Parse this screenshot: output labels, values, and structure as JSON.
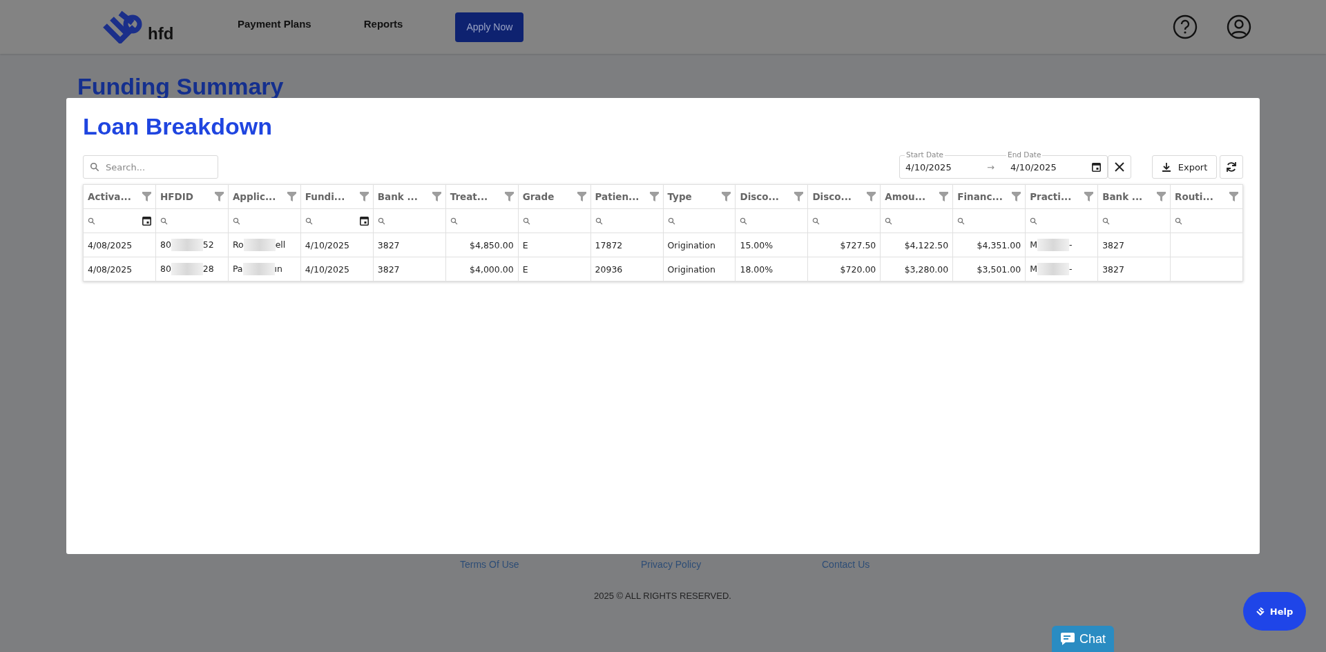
{
  "nav": {
    "logo": "hfd",
    "links": [
      "Payment Plans",
      "Reports"
    ],
    "apply_button": "Apply Now"
  },
  "page_title": "Funding Summary",
  "modal": {
    "title": "Loan Breakdown",
    "search": {
      "placeholder": "Search..."
    },
    "date_range": {
      "start_label": "Start Date",
      "start": "4/10/2025",
      "arrow": "→",
      "end_label": "End Date",
      "end": "4/10/2025"
    },
    "export_button": "Export",
    "table": {
      "columns": [
        {
          "label": "Activa...",
          "date_filter": true,
          "right_aligned": false
        },
        {
          "label": "HFDID",
          "date_filter": false,
          "right_aligned": false
        },
        {
          "label": "Applic...",
          "date_filter": false,
          "right_aligned": false
        },
        {
          "label": "Fundi...",
          "date_filter": true,
          "right_aligned": false
        },
        {
          "label": "Bank ...",
          "date_filter": false,
          "right_aligned": false
        },
        {
          "label": "Treat...",
          "date_filter": false,
          "right_aligned": true
        },
        {
          "label": "Grade",
          "date_filter": false,
          "right_aligned": false
        },
        {
          "label": "Patien...",
          "date_filter": false,
          "right_aligned": false
        },
        {
          "label": "Type",
          "date_filter": false,
          "right_aligned": false
        },
        {
          "label": "Disco...",
          "date_filter": false,
          "right_aligned": false
        },
        {
          "label": "Disco...",
          "date_filter": false,
          "right_aligned": true
        },
        {
          "label": "Amou...",
          "date_filter": false,
          "right_aligned": true
        },
        {
          "label": "Financ...",
          "date_filter": false,
          "right_aligned": true
        },
        {
          "label": "Practi...",
          "date_filter": false,
          "right_aligned": false
        },
        {
          "label": "Bank ...",
          "date_filter": false,
          "right_aligned": false
        },
        {
          "label": "Routi...",
          "date_filter": false
        }
      ],
      "rows": [
        [
          {
            "text": "4/08/2025"
          },
          {
            "text": "80",
            "after": "52"
          },
          {
            "text": "Ro",
            "after": "ell"
          },
          {
            "text": "4/10/2025"
          },
          {
            "text": "3827"
          },
          {
            "text": "$4,850.00"
          },
          {
            "text": "E"
          },
          {
            "text": "17872"
          },
          {
            "text": "Origination"
          },
          {
            "text": "15.00%"
          },
          {
            "text": "$727.50"
          },
          {
            "text": "$4,122.50"
          },
          {
            "text": "$4,351.00"
          },
          {
            "text": "M",
            "after": "-"
          },
          {
            "text": "3827"
          },
          {
            "text": ""
          }
        ],
        [
          {
            "text": "4/08/2025"
          },
          {
            "text": "80",
            "after": "28"
          },
          {
            "text": "Pa",
            "after": "ın"
          },
          {
            "text": "4/10/2025"
          },
          {
            "text": "3827"
          },
          {
            "text": "$4,000.00"
          },
          {
            "text": "E"
          },
          {
            "text": "20936"
          },
          {
            "text": "Origination"
          },
          {
            "text": "18.00%"
          },
          {
            "text": "$720.00"
          },
          {
            "text": "$3,280.00"
          },
          {
            "text": "$3,501.00"
          },
          {
            "text": "M",
            "after": "-"
          },
          {
            "text": "3827"
          },
          {
            "text": ""
          }
        ]
      ]
    }
  },
  "footer": {
    "links": [
      "Terms Of Use",
      "Privacy Policy",
      "Contact Us"
    ],
    "copyright": "2025 © ALL RIGHTS RESERVED."
  },
  "help_button": "Help",
  "chat_button": "Chat"
}
